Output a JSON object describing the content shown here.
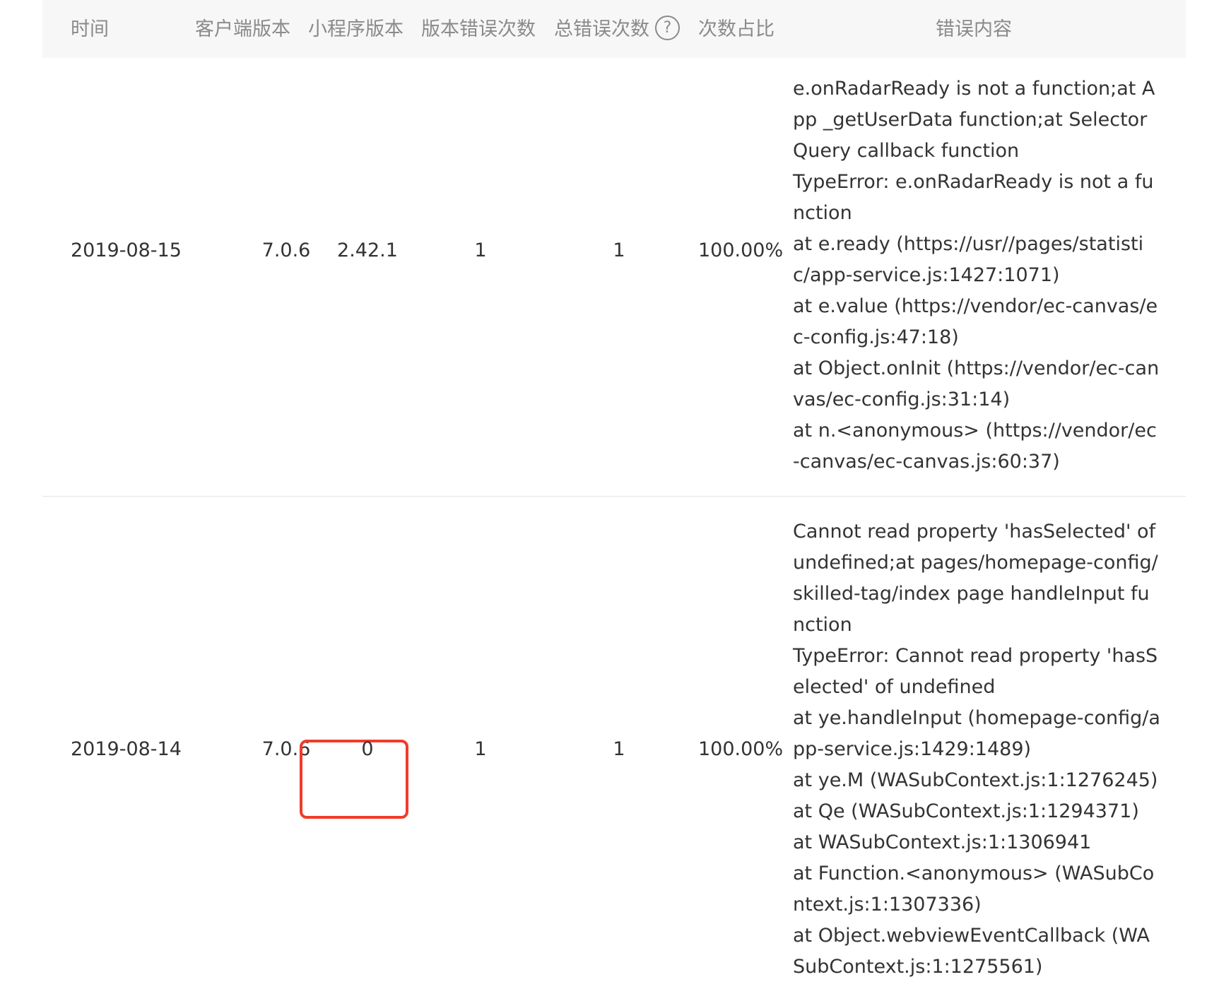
{
  "headers": {
    "time": "时间",
    "client_version": "客户端版本",
    "miniprogram_version": "小程序版本",
    "version_error_count": "版本错误次数",
    "total_error_count": "总错误次数",
    "help_icon_glyph": "?",
    "ratio": "次数占比",
    "error_content": "错误内容"
  },
  "rows": [
    {
      "time": "2019-08-15",
      "client_version": "7.0.6",
      "miniprogram_version": "2.42.1",
      "version_error_count": "1",
      "total_error_count": "1",
      "ratio": "100.00%",
      "error_lines": [
        "e.onRadarReady is not a function;at App _getUserData function;at SelectorQuery callback function",
        "TypeError: e.onRadarReady is not a function",
        "at e.ready (https://usr//pages/statistic/app-service.js:1427:1071)",
        "at e.value (https://vendor/ec-canvas/ec-config.js:47:18)",
        "at Object.onInit (https://vendor/ec-canvas/ec-config.js:31:14)",
        "at n.<anonymous> (https://vendor/ec-canvas/ec-canvas.js:60:37)"
      ]
    },
    {
      "time": "2019-08-14",
      "client_version": "7.0.6",
      "miniprogram_version": "0",
      "version_error_count": "1",
      "total_error_count": "1",
      "ratio": "100.00%",
      "error_lines": [
        "Cannot read property 'hasSelected' of undefined;at pages/homepage-config/skilled-tag/index page handleInput function",
        "TypeError: Cannot read property 'hasSelected' of undefined",
        "at ye.handleInput (homepage-config/app-service.js:1429:1489)",
        "at ye.M (WASubContext.js:1:1276245)",
        "at Qe (WASubContext.js:1:1294371)",
        "at WASubContext.js:1:1306941",
        "at Function.<anonymous> (WASubContext.js:1:1307336)",
        "at Object.webviewEventCallback (WASubContext.js:1:1275561)"
      ]
    }
  ],
  "colors": {
    "header_bg": "#f7f7f8",
    "header_text": "#8a8a8a",
    "body_text": "#333333",
    "highlight": "#f03c2a",
    "divider": "#e4e4e4"
  }
}
